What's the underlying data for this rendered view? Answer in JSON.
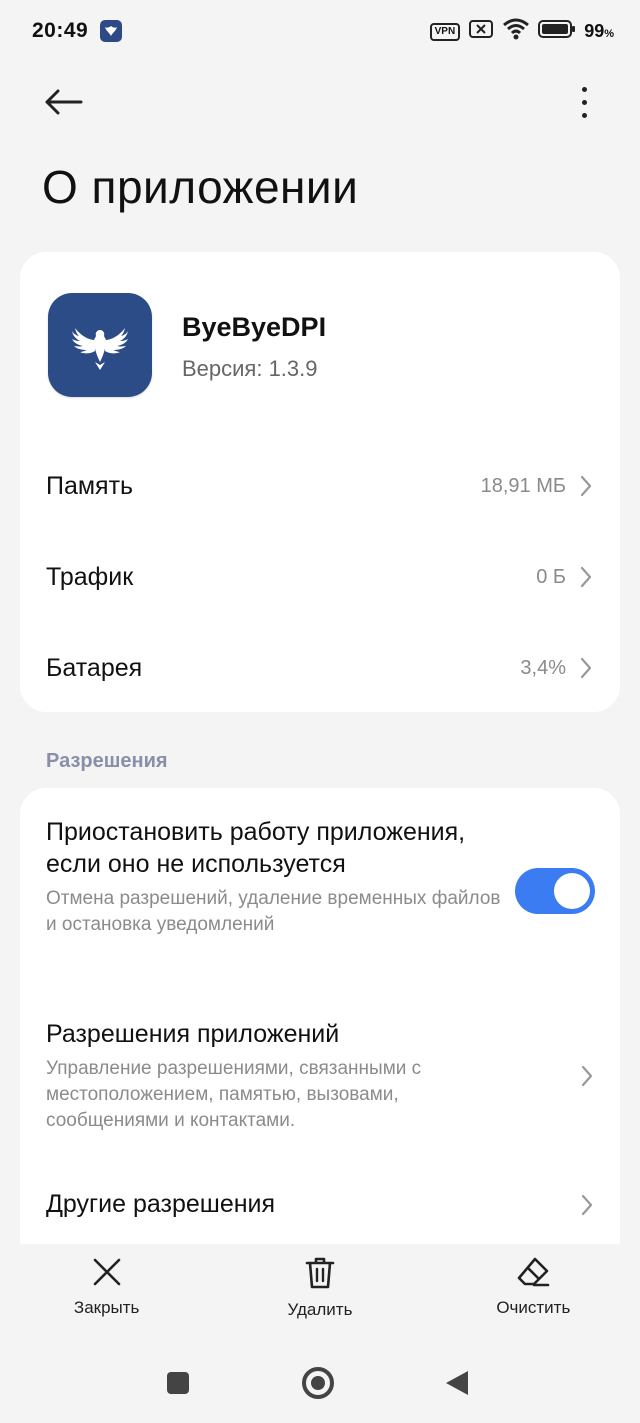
{
  "status_bar": {
    "time": "20:49",
    "vpn_label": "VPN",
    "battery_percent": "99",
    "battery_unit": "%"
  },
  "header": {
    "title": "О приложении"
  },
  "app": {
    "name": "ByeByeDPI",
    "version": "Версия: 1.3.9",
    "icon_color": "#2c4c87"
  },
  "info_rows": [
    {
      "label": "Память",
      "value": "18,91 МБ"
    },
    {
      "label": "Трафик",
      "value": "0 Б"
    },
    {
      "label": "Батарея",
      "value": "3,4%"
    }
  ],
  "permissions_section": {
    "title": "Разрешения",
    "items": [
      {
        "title": "Приостановить работу приложения, если оно не используется",
        "description": "Отмена разрешений, удаление временных файлов и остановка уведомлений",
        "toggle_on": true
      },
      {
        "title": "Разрешения приложений",
        "description": "Управление разрешениями, связанными с местоположением, памятью, вызовами, сообщениями и контактами."
      },
      {
        "title": "Другие разрешения",
        "description": ""
      }
    ]
  },
  "bottom_actions": [
    {
      "label": "Закрыть",
      "icon": "close-icon"
    },
    {
      "label": "Удалить",
      "icon": "trash-icon"
    },
    {
      "label": "Очистить",
      "icon": "eraser-icon"
    }
  ],
  "colors": {
    "accent": "#3b7cf2",
    "section_title": "#8790a8",
    "background": "#f4f4f4"
  }
}
